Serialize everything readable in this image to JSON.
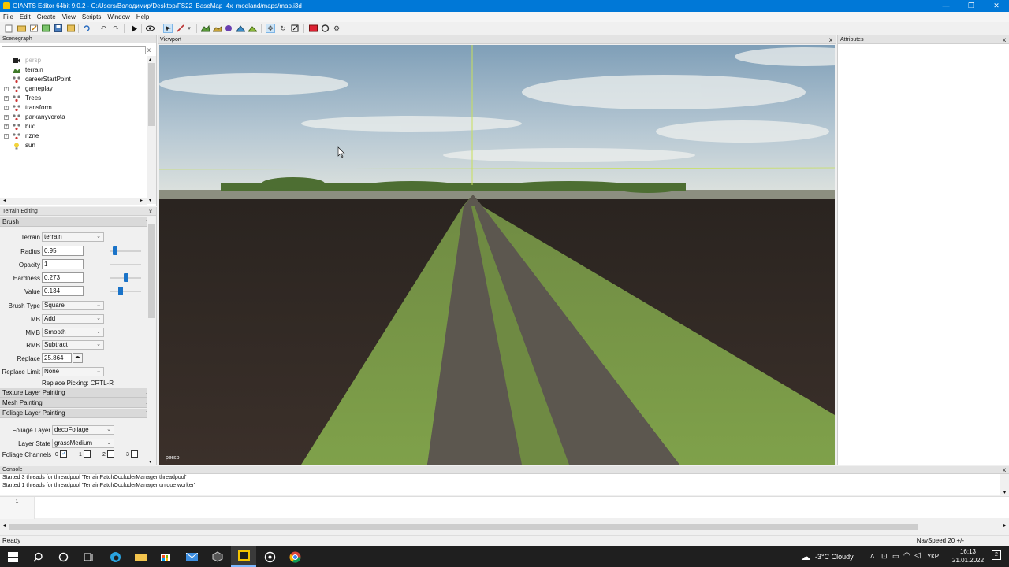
{
  "window": {
    "title": "GIANTS Editor 64bit 9.0.2 - C:/Users/Володимир/Desktop/FS22_BaseMap_4x_modland/maps/map.i3d",
    "minimize": "—",
    "maximize": "❐",
    "close": "✕"
  },
  "menu": [
    "File",
    "Edit",
    "Create",
    "View",
    "Scripts",
    "Window",
    "Help"
  ],
  "scenegraph": {
    "title": "Scenegraph",
    "close": "x",
    "filter_clear": "x",
    "items": [
      {
        "label": "persp",
        "icon": "camera-icon",
        "expandable": false,
        "dim": true
      },
      {
        "label": "terrain",
        "icon": "terrain-icon",
        "expandable": false,
        "dim": false
      },
      {
        "label": "careerStartPoint",
        "icon": "transform-icon",
        "expandable": false,
        "dim": false
      },
      {
        "label": "gameplay",
        "icon": "transform-icon",
        "expandable": true,
        "dim": false
      },
      {
        "label": "Trees",
        "icon": "transform-icon",
        "expandable": true,
        "dim": false
      },
      {
        "label": "transform",
        "icon": "transform-icon",
        "expandable": true,
        "dim": false
      },
      {
        "label": "parkanyvorota",
        "icon": "transform-icon",
        "expandable": true,
        "dim": false
      },
      {
        "label": "bud",
        "icon": "transform-icon",
        "expandable": true,
        "dim": false
      },
      {
        "label": "rizne",
        "icon": "transform-icon",
        "expandable": true,
        "dim": false
      },
      {
        "label": "sun",
        "icon": "light-icon",
        "expandable": false,
        "dim": false
      }
    ]
  },
  "terrain_editing": {
    "title": "Terrain Editing",
    "close": "x",
    "brush_header": "Brush",
    "fields": {
      "terrain_label": "Terrain",
      "terrain_value": "terrain",
      "radius_label": "Radius",
      "radius_value": "0.95",
      "radius_slider": 0.1,
      "opacity_label": "Opacity",
      "opacity_value": "1",
      "opacity_slider": 1.0,
      "hardness_label": "Hardness",
      "hardness_value": "0.273",
      "hardness_slider": 0.5,
      "value_label": "Value",
      "value_value": "0.134",
      "value_slider": 0.3,
      "brush_type_label": "Brush Type",
      "brush_type_value": "Square",
      "lmb_label": "LMB",
      "lmb_value": "Add",
      "mmb_label": "MMB",
      "mmb_value": "Smooth",
      "rmb_label": "RMB",
      "rmb_value": "Subtract",
      "replace_label": "Replace",
      "replace_value": "25.864",
      "replace_limit_label": "Replace Limit",
      "replace_limit_value": "None",
      "replace_picking": "Replace Picking: CRTL-R"
    },
    "sections": [
      "Texture Layer Painting",
      "Mesh Painting",
      "Foliage Layer Painting"
    ],
    "foliage": {
      "layer_label": "Foliage Layer",
      "layer_value": "decoFoliage",
      "state_label": "Layer State",
      "state_value": "grassMedium",
      "channels_label": "Foliage Channels",
      "channels": [
        "0",
        "1",
        "2",
        "3"
      ],
      "channels_checked": [
        true,
        false,
        false,
        false
      ]
    }
  },
  "viewport": {
    "title": "Viewport",
    "close": "x",
    "camera": "persp"
  },
  "attributes": {
    "title": "Attributes",
    "close": "x"
  },
  "console": {
    "title": "Console",
    "close": "x",
    "lines": [
      "Started 3 threads for threadpool 'TerrainPatchOccluderManager threadpool'",
      "Started 1 threads for threadpool 'TerrainPatchOccluderManager unique worker'"
    ],
    "line_number": "1"
  },
  "status": {
    "left": "Ready",
    "right": "NavSpeed 20 +/-"
  },
  "taskbar": {
    "weather": "-3°C  Cloudy",
    "lang": "УКР",
    "time": "16:13",
    "date": "21.01.2022",
    "notifications": "2"
  },
  "colors": {
    "titlebar": "#0078d7",
    "accent": "#1a73c8",
    "taskbar": "#1f1f1f"
  }
}
